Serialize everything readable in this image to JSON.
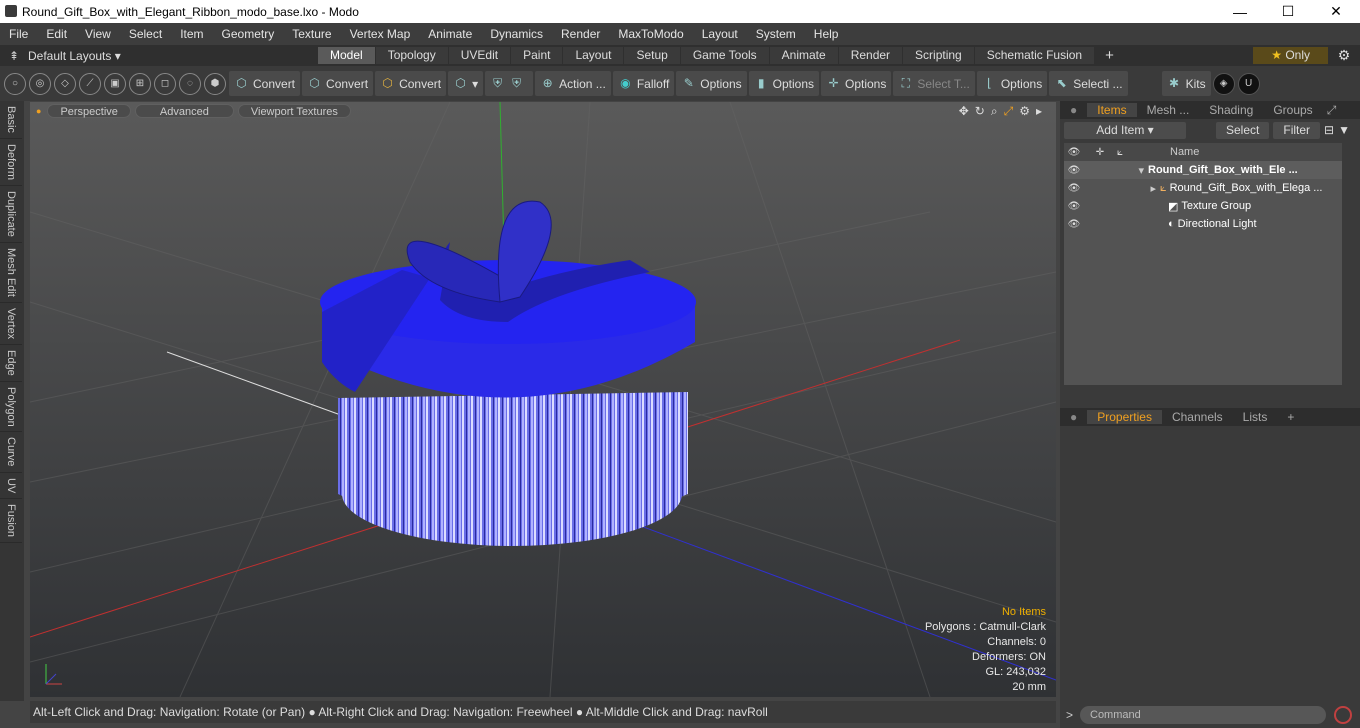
{
  "window": {
    "title": "Round_Gift_Box_with_Elegant_Ribbon_modo_base.lxo - Modo",
    "minimize": "—",
    "maximize": "☐",
    "close": "✕"
  },
  "menu": [
    "File",
    "Edit",
    "View",
    "Select",
    "Item",
    "Geometry",
    "Texture",
    "Vertex Map",
    "Animate",
    "Dynamics",
    "Render",
    "MaxToModo",
    "Layout",
    "System",
    "Help"
  ],
  "layouts_label": "Default Layouts ▾",
  "tabs": [
    "Model",
    "Topology",
    "UVEdit",
    "Paint",
    "Layout",
    "Setup",
    "Game Tools",
    "Animate",
    "Render",
    "Scripting",
    "Schematic Fusion"
  ],
  "active_tab": "Model",
  "only_label": "Only",
  "toolbar": {
    "convert1": "Convert",
    "convert2": "Convert",
    "convert3": "Convert",
    "action": "Action ...",
    "falloff": "Falloff",
    "options1": "Options",
    "options2": "Options",
    "options3": "Options",
    "select_t": "Select T...",
    "options4": "Options",
    "selecti": "Selecti ...",
    "kits": "Kits"
  },
  "left_tabs": [
    "Basic",
    "Deform",
    "Duplicate",
    "Mesh Edit",
    "Vertex",
    "Edge",
    "Polygon",
    "Curve",
    "UV",
    "Fusion"
  ],
  "viewport": {
    "perspective": "Perspective",
    "advanced": "Advanced",
    "textures": "Viewport Textures",
    "info": {
      "items": "No Items",
      "polygons": "Polygons : Catmull-Clark",
      "channels": "Channels: 0",
      "deformers": "Deformers: ON",
      "gl": "GL: 243,032",
      "scale": "20 mm"
    }
  },
  "status": "Alt-Left Click and Drag: Navigation: Rotate (or Pan) ● Alt-Right Click and Drag: Navigation: Freewheel ● Alt-Middle Click and Drag: navRoll",
  "panel": {
    "tabs": [
      "Items",
      "Mesh ...",
      "Shading",
      "Groups"
    ],
    "add_item": "Add Item",
    "select": "Select",
    "filter": "Filter",
    "name_col": "Name",
    "items": [
      {
        "label": "Round_Gift_Box_with_Ele ...",
        "bold": true
      },
      {
        "label": "Round_Gift_Box_with_Elega ..."
      },
      {
        "label": "Texture Group"
      },
      {
        "label": "Directional Light"
      }
    ]
  },
  "props_tabs": [
    "Properties",
    "Channels",
    "Lists"
  ],
  "command_placeholder": "Command"
}
